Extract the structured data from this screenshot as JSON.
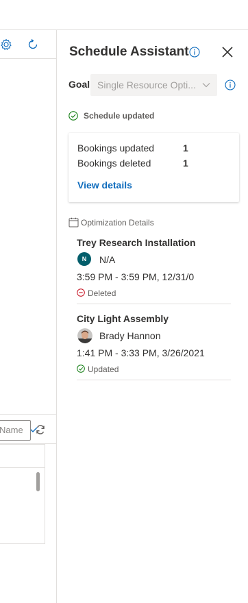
{
  "left_pane": {
    "name_placeholder": "Name"
  },
  "panel": {
    "title": "Schedule Assistant",
    "goal_label": "Goal",
    "goal_value": "Single Resource Opti...",
    "status_text": "Schedule updated",
    "summary": {
      "rows": [
        {
          "label": "Bookings updated",
          "value": "1"
        },
        {
          "label": "Bookings deleted",
          "value": "1"
        }
      ],
      "link": "View details"
    },
    "optimization_header": "Optimization Details",
    "items": [
      {
        "name": "Trey Research Installation",
        "avatar_initial": "N",
        "resource": "N/A",
        "time": "3:59 PM - 3:59 PM, 12/31/0",
        "status": "Deleted",
        "status_color": "#c50f1f"
      },
      {
        "name": "City Light Assembly",
        "resource": "Brady Hannon",
        "time": "1:41 PM - 3:33 PM, 3/26/2021",
        "status": "Updated",
        "status_color": "#107c10"
      }
    ]
  },
  "colors": {
    "accent": "#0f6cbd",
    "success": "#107c10",
    "danger": "#c50f1f",
    "avatar_teal": "#035e6b"
  },
  "icons": {
    "toolbar": [
      "gear-icon",
      "refresh-icon"
    ],
    "title": [
      "info-icon",
      "close-icon"
    ],
    "goal": [
      "chevron-down-icon",
      "info-icon"
    ],
    "status": "check-circle-icon",
    "section": "calendar-icon",
    "deleted": "minus-circle-icon",
    "updated": "check-circle-icon"
  }
}
